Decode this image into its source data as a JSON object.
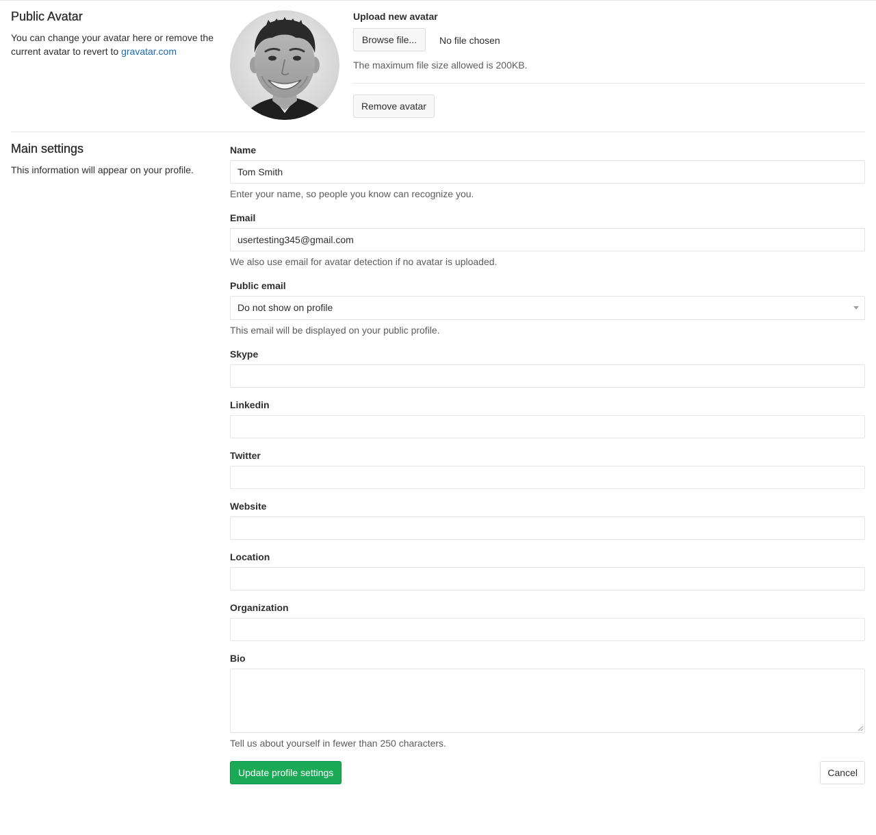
{
  "avatar_section": {
    "title": "Public Avatar",
    "description_prefix": "You can change your avatar here or remove the current avatar to revert to ",
    "gravatar_link": "gravatar.com",
    "upload_label": "Upload new avatar",
    "browse_button": "Browse file...",
    "no_file_text": "No file chosen",
    "size_help": "The maximum file size allowed is 200KB.",
    "remove_button": "Remove avatar"
  },
  "main_section": {
    "title": "Main settings",
    "description": "This information will appear on your profile."
  },
  "fields": {
    "name": {
      "label": "Name",
      "value": "Tom Smith",
      "help": "Enter your name, so people you know can recognize you."
    },
    "email": {
      "label": "Email",
      "value": "usertesting345@gmail.com",
      "help": "We also use email for avatar detection if no avatar is uploaded."
    },
    "public_email": {
      "label": "Public email",
      "selected": "Do not show on profile",
      "help": "This email will be displayed on your public profile."
    },
    "skype": {
      "label": "Skype",
      "value": ""
    },
    "linkedin": {
      "label": "Linkedin",
      "value": ""
    },
    "twitter": {
      "label": "Twitter",
      "value": ""
    },
    "website": {
      "label": "Website",
      "value": ""
    },
    "location": {
      "label": "Location",
      "value": ""
    },
    "organization": {
      "label": "Organization",
      "value": ""
    },
    "bio": {
      "label": "Bio",
      "value": "",
      "help": "Tell us about yourself in fewer than 250 characters."
    }
  },
  "actions": {
    "submit": "Update profile settings",
    "cancel": "Cancel"
  },
  "colors": {
    "primary_button": "#1aaa55",
    "link": "#1b69b6",
    "border": "#e5e5e5",
    "help_text": "#5c5c5c"
  }
}
